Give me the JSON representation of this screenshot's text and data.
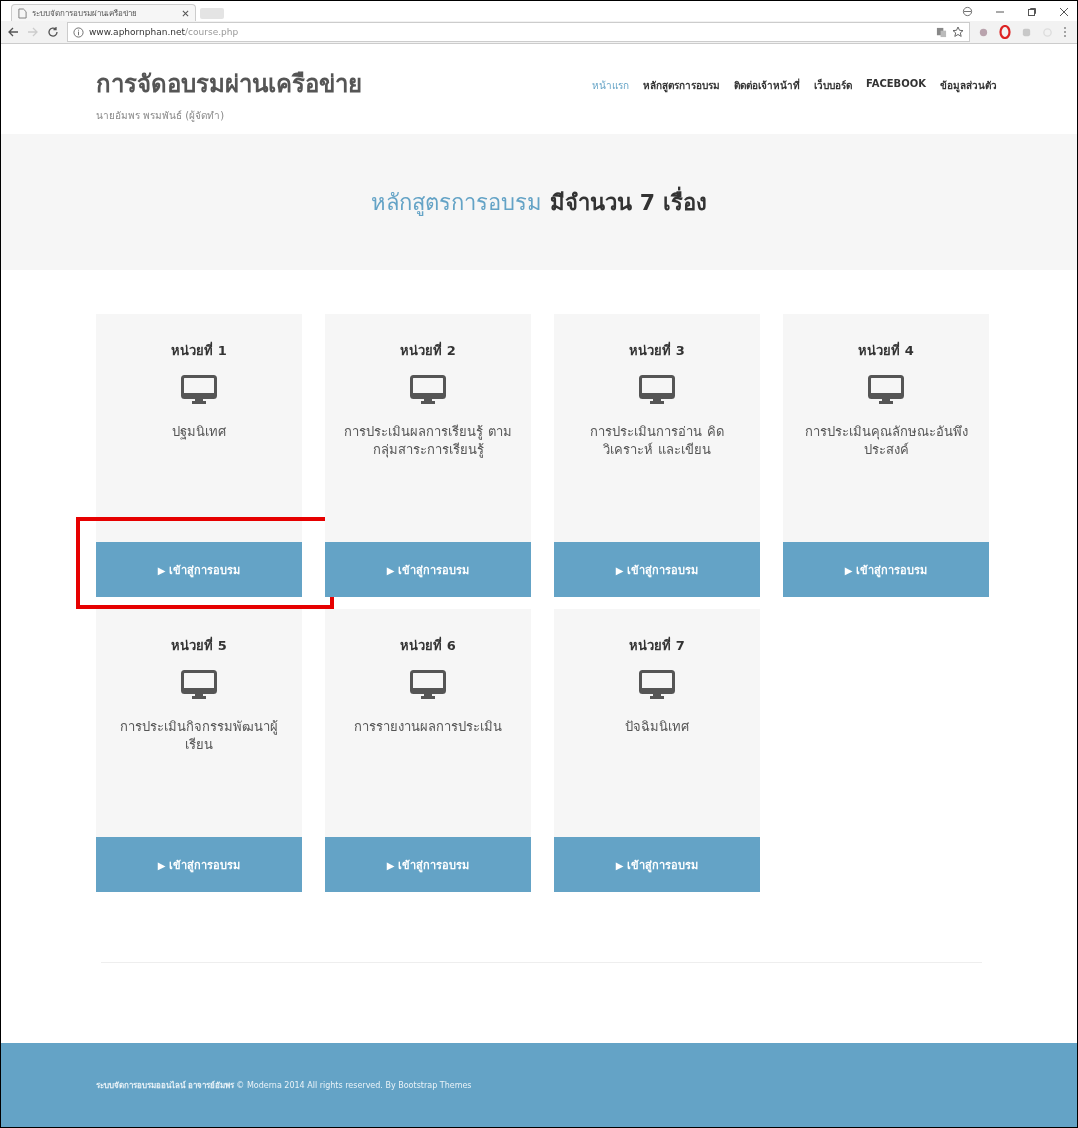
{
  "browser": {
    "tab_title": "ระบบจัดการอบรมผ่านเครือข่าย",
    "url_host": "www.aphornphan.net",
    "url_path": "/course.php"
  },
  "site": {
    "title": "การจัดอบรมผ่านเครือข่าย",
    "subtitle": "นายอัมพร พรมพันธ์ (ผู้จัดทำ)"
  },
  "nav": [
    {
      "label": "หน้าแรก",
      "selected": true
    },
    {
      "label": "หลักสูตรการอบรม",
      "selected": false
    },
    {
      "label": "ติดต่อเจ้าหน้าที่",
      "selected": false
    },
    {
      "label": "เว็บบอร์ด",
      "selected": false
    },
    {
      "label": "FACEBOOK",
      "selected": false
    },
    {
      "label": "ข้อมูลส่วนตัว",
      "selected": false
    }
  ],
  "hero": {
    "highlight": "หลักสูตรการอบรม",
    "rest": "มีจำนวน 7 เรื่อง"
  },
  "courses": [
    {
      "unit": "หน่วยที่ 1",
      "title": "ปฐมนิเทศ",
      "button": "เข้าสู่การอบรม",
      "highlighted": true
    },
    {
      "unit": "หน่วยที่ 2",
      "title": "การประเมินผลการเรียนรู้ ตามกลุ่มสาระการเรียนรู้",
      "button": "เข้าสู่การอบรม",
      "highlighted": false
    },
    {
      "unit": "หน่วยที่ 3",
      "title": "การประเมินการอ่าน คิด วิเคราะห์ และเขียน",
      "button": "เข้าสู่การอบรม",
      "highlighted": false
    },
    {
      "unit": "หน่วยที่ 4",
      "title": "การประเมินคุณลักษณะอันพึงประสงค์",
      "button": "เข้าสู่การอบรม",
      "highlighted": false
    },
    {
      "unit": "หน่วยที่ 5",
      "title": "การประเมินกิจกรรมพัฒนาผู้เรียน",
      "button": "เข้าสู่การอบรม",
      "highlighted": false
    },
    {
      "unit": "หน่วยที่ 6",
      "title": "การรายงานผลการประเมิน",
      "button": "เข้าสู่การอบรม",
      "highlighted": false
    },
    {
      "unit": "หน่วยที่ 7",
      "title": "ปัจฉิมนิเทศ",
      "button": "เข้าสู่การอบรม",
      "highlighted": false
    }
  ],
  "play_glyph": "▶",
  "footer": {
    "owner": "ระบบจัดการอบรมออนไลน์ อาจารย์อัมพร",
    "copyright": "© Moderna 2014 All rights reserved. By Bootstrap Themes"
  }
}
